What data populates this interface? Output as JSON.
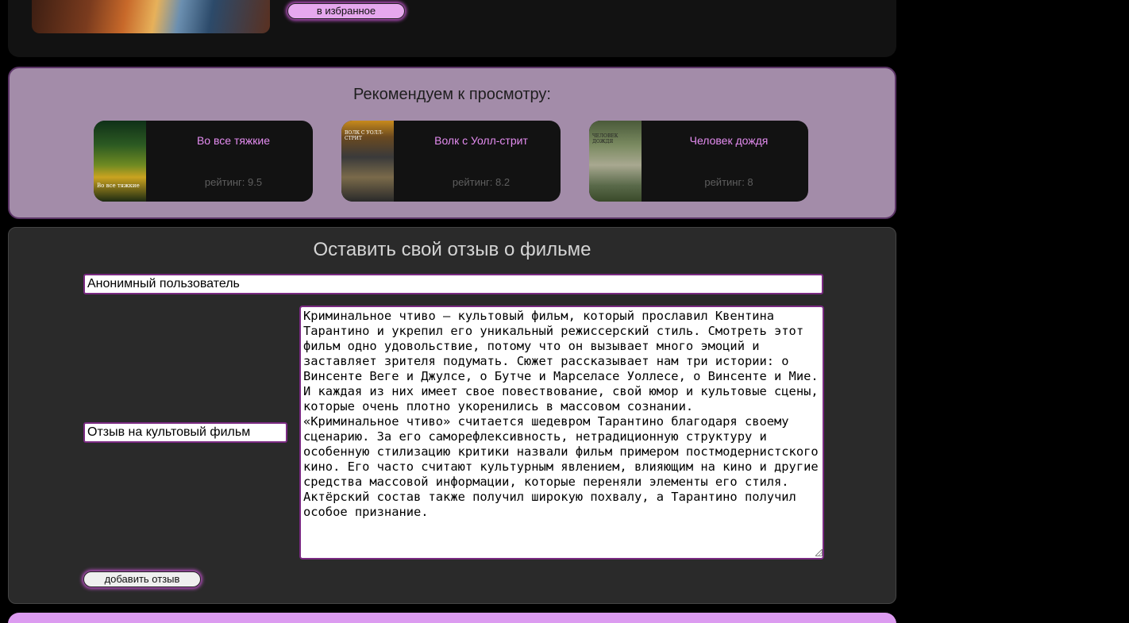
{
  "favorite": {
    "button_label": "в избранное"
  },
  "recommendations": {
    "title": "Рекомендуем к просмотру:",
    "cards": [
      {
        "title": "Во все тяжкие",
        "rating": "рейтинг: 9.5",
        "poster_text": "Во все тяжкие"
      },
      {
        "title": "Волк с Уолл-стрит",
        "rating": "рейтинг: 8.2",
        "poster_text": "ВОЛК С УОЛЛ-СТРИТ"
      },
      {
        "title": "Человек дождя",
        "rating": "рейтинг: 8",
        "poster_text": "ЧЕЛОВЕК ДОЖДЯ"
      }
    ]
  },
  "review_form": {
    "title": "Оставить свой отзыв о фильме",
    "author_value": "Анонимный пользователь",
    "subject_value": "Отзыв на культовый фильм",
    "review_text": "Криминальное чтиво — культовый фильм, который прославил Квентина Тарантино и укрепил его уникальный режиссерский стиль. Смотреть этот фильм одно удовольствие, потому что он вызывает много эмоций и заставляет зрителя подумать. Сюжет рассказывает нам три истории: о Винсенте Веге и Джулсе, о Бутче и Марселасе Уоллесе, о Винсенте и Мие. И каждая из них имеет свое повествование, свой юмор и культовые сцены, которые очень плотно укоренились в массовом сознании.\n«Криминальное чтиво» считается шедевром Тарантино благодаря своему сценарию. За его саморефлексивность, нетрадиционную структуру и особенную стилизацию критики назвали фильм примером постмодернистского кино. Его часто считают культурным явлением, влияющим на кино и другие средства массовой информации, которые переняли элементы его стиля. Актёрский состав также получил широкую похвалу, а Тарантино получил особое признание. ",
    "submit_label": "добавить отзыв"
  }
}
